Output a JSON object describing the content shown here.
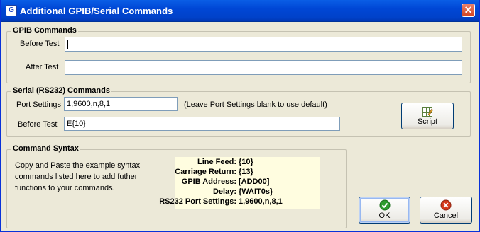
{
  "window": {
    "title": "Additional GPIB/Serial Commands",
    "close_glyph": "✕",
    "app_icon": "app-icon"
  },
  "gpib": {
    "title": "GPIB Commands",
    "before_label": "Before Test",
    "before_value": "",
    "after_label": "After Test",
    "after_value": ""
  },
  "serial": {
    "title": "Serial (RS232) Commands",
    "port_label": "Port Settings",
    "port_value": "1,9600,n,8,1",
    "port_hint": "(Leave Port Settings blank to use default)",
    "before_label": "Before Test",
    "before_value": "E{10}",
    "script_label": "Script"
  },
  "syntax": {
    "title": "Command Syntax",
    "description": "Copy and Paste the example syntax commands listed here to add futher functions to your commands.",
    "rows": [
      {
        "key": "Line Feed:",
        "value": "{10}"
      },
      {
        "key": "Carriage Return:",
        "value": "{13}"
      },
      {
        "key": "GPIB Address:",
        "value": "[ADD00]"
      },
      {
        "key": "Delay:",
        "value": "{WAIT0s}"
      },
      {
        "key": "RS232 Port Settings:",
        "value": "1,9600,n,8,1"
      }
    ]
  },
  "buttons": {
    "ok_label": "OK",
    "cancel_label": "Cancel"
  },
  "colors": {
    "titlebar": "#0054e3",
    "dialog_bg": "#ece9d8",
    "syntax_bg": "#fffde0",
    "ok_icon": "#2e9b2e",
    "cancel_icon": "#d3391c"
  }
}
